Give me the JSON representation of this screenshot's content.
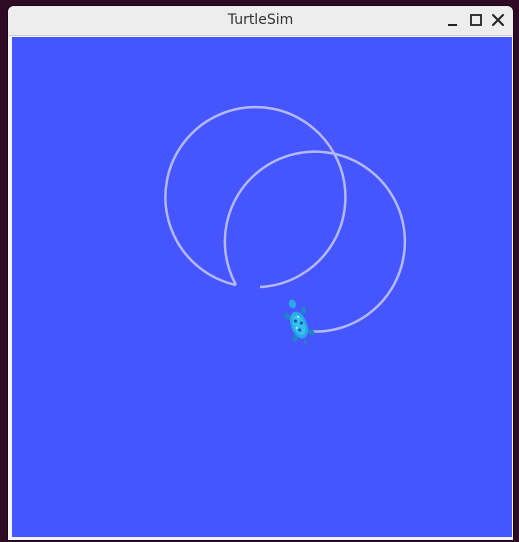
{
  "window": {
    "title": "TurtleSim",
    "controls": [
      "minimize",
      "maximize",
      "close"
    ]
  },
  "canvas": {
    "background_color": "#4556ff",
    "pen_color": "#b3b8ff",
    "turtle_icon": "turtle-icon",
    "turtle_color": "#29a9e6"
  }
}
